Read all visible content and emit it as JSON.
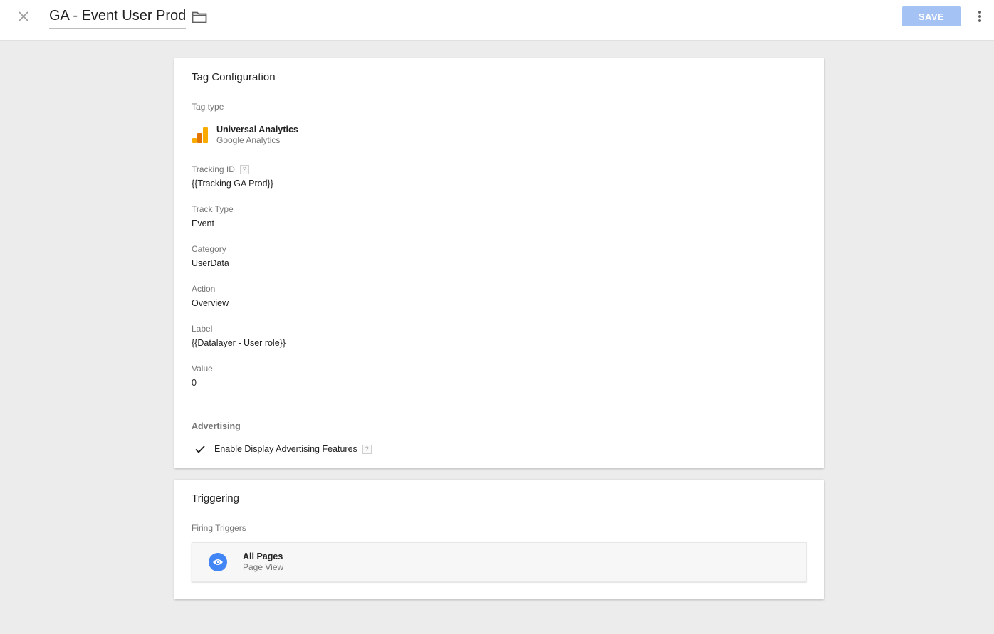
{
  "header": {
    "title": "GA - Event User Prod",
    "save_label": "SAVE"
  },
  "tag_config": {
    "heading": "Tag Configuration",
    "tag_type_label": "Tag type",
    "tag_type_name": "Universal Analytics",
    "tag_type_vendor": "Google Analytics",
    "fields": [
      {
        "label": "Tracking ID",
        "value": "{{Tracking GA Prod}}",
        "help": "?"
      },
      {
        "label": "Track Type",
        "value": "Event"
      },
      {
        "label": "Category",
        "value": "UserData"
      },
      {
        "label": "Action",
        "value": "Overview"
      },
      {
        "label": "Label",
        "value": "{{Datalayer - User role}}"
      },
      {
        "label": "Value",
        "value": "0"
      }
    ],
    "advertising": {
      "heading": "Advertising",
      "option_label": "Enable Display Advertising Features",
      "option_checked": true,
      "help": "?"
    }
  },
  "triggering": {
    "heading": "Triggering",
    "firing_label": "Firing Triggers",
    "triggers": [
      {
        "name": "All Pages",
        "type": "Page View",
        "icon": "eye-icon"
      }
    ]
  },
  "colors": {
    "accent": "#4285f4",
    "save_disabled": "#a4c2f4",
    "background": "#ececec"
  }
}
